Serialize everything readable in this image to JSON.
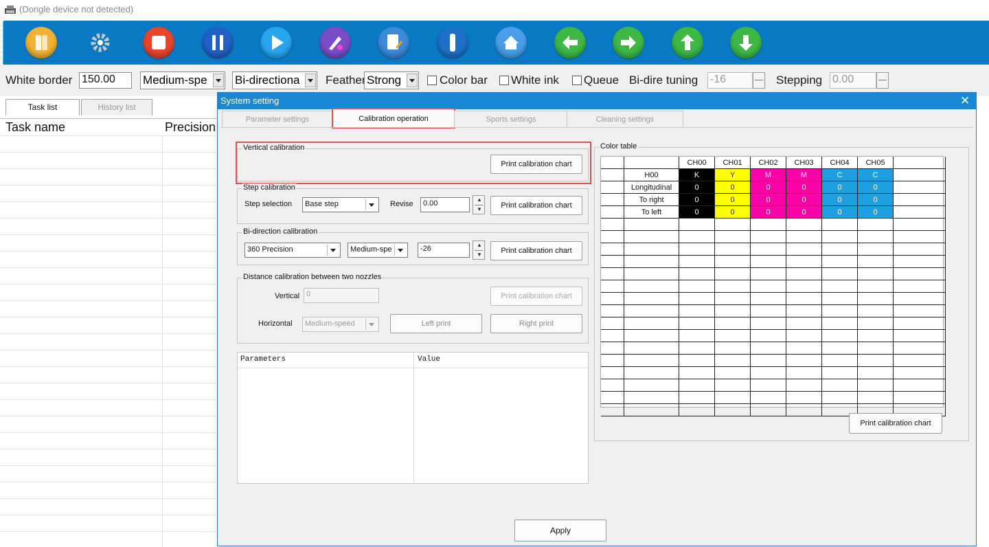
{
  "window": {
    "status_text": "(Dongle device not detected)"
  },
  "toolbar": {
    "buttons": [
      {
        "name": "open-file-button",
        "icon": "book-icon",
        "color": "#f2b233"
      },
      {
        "name": "settings-button",
        "icon": "gear-icon",
        "color": "#c8c8c8"
      },
      {
        "name": "stop-button",
        "icon": "stop-icon",
        "color": "#e8452c"
      },
      {
        "name": "pause-button",
        "icon": "pause-icon",
        "color": "#2160c4"
      },
      {
        "name": "play-button",
        "icon": "play-icon",
        "color": "#27a6f0"
      },
      {
        "name": "color-button",
        "icon": "palette-icon",
        "color": "#7a4cc8"
      },
      {
        "name": "edit-button",
        "icon": "document-edit-icon",
        "color": "#3c8ad8"
      },
      {
        "name": "info-button",
        "icon": "ink-bottle-icon",
        "color": "#1e6fc8"
      },
      {
        "name": "home-button",
        "icon": "home-icon",
        "color": "#4a9ee8"
      },
      {
        "name": "left-button",
        "icon": "arrow-left-icon",
        "color": "#3db845"
      },
      {
        "name": "right-button",
        "icon": "arrow-right-icon",
        "color": "#3db845"
      },
      {
        "name": "up-button",
        "icon": "arrow-up-icon",
        "color": "#3db845"
      },
      {
        "name": "down-button",
        "icon": "arrow-down-icon",
        "color": "#3db845"
      }
    ]
  },
  "params": {
    "white_border_label": "White border",
    "white_border_value": "150.00",
    "speed_value": "Medium-spe",
    "direction_value": "Bi-directiona",
    "feather_label": "Feather",
    "feather_value": "Strong",
    "color_bar_label": "Color bar",
    "white_ink_label": "White ink",
    "queue_label": "Queue",
    "bidir_tuning_label": "Bi-dire tuning",
    "bidir_tuning_value": "-16",
    "stepping_label": "Stepping",
    "stepping_value": "0.00"
  },
  "task_panel": {
    "tabs": [
      "Task list",
      "History list"
    ],
    "columns": [
      "Task name",
      "Precision"
    ]
  },
  "dialog": {
    "title": "System setting",
    "close": "✕",
    "tabs": [
      "Parameter settings",
      "Calibration operation",
      "Sports settings",
      "Cleaning settings"
    ],
    "vertical": {
      "title": "Vertical calibration",
      "button": "Print calibration chart"
    },
    "step": {
      "title": "Step calibration",
      "step_label": "Step selection",
      "step_value": "Base step",
      "revise_label": "Revise",
      "revise_value": "0.00",
      "button": "Print calibration chart"
    },
    "bidir": {
      "title": "Bi-direction calibration",
      "precision_value": "360 Precision",
      "speed_value": "Medium-spe",
      "offset_value": "-26",
      "button": "Print calibration chart"
    },
    "distance": {
      "title": "Distance calibration between two nozzles",
      "vertical_label": "Vertical",
      "vertical_value": "0",
      "button": "Print calibration chart",
      "horizontal_label": "Horizontal",
      "horizontal_value": "Medium-speed",
      "left_button": "Left print",
      "right_button": "Right print"
    },
    "param_table": {
      "columns": [
        "Parameters",
        "Value"
      ]
    },
    "color_table": {
      "title": "Color table",
      "channels": [
        "CH00",
        "CH01",
        "CH02",
        "CH03",
        "CH04",
        "CH05"
      ],
      "rows": [
        {
          "label": "H00",
          "cells": [
            "K",
            "Y",
            "M",
            "M",
            "C",
            "C"
          ]
        },
        {
          "label": "Longitudinal",
          "cells": [
            "0",
            "0",
            "0",
            "0",
            "0",
            "0"
          ]
        },
        {
          "label": "To right",
          "cells": [
            "0",
            "0",
            "0",
            "0",
            "0",
            "0"
          ]
        },
        {
          "label": "To left",
          "cells": [
            "0",
            "0",
            "0",
            "0",
            "0",
            "0"
          ]
        }
      ],
      "channel_colors": [
        "#000000",
        "#ffff00",
        "#ff00a8",
        "#ff00a8",
        "#1ea0e0",
        "#1ea0e0"
      ],
      "channel_text_colors": [
        "#ffffff",
        "#333333",
        "#ffffff",
        "#ffffff",
        "#ffffff",
        "#ffffff"
      ],
      "button": "Print calibration chart"
    },
    "apply_button": "Apply"
  }
}
